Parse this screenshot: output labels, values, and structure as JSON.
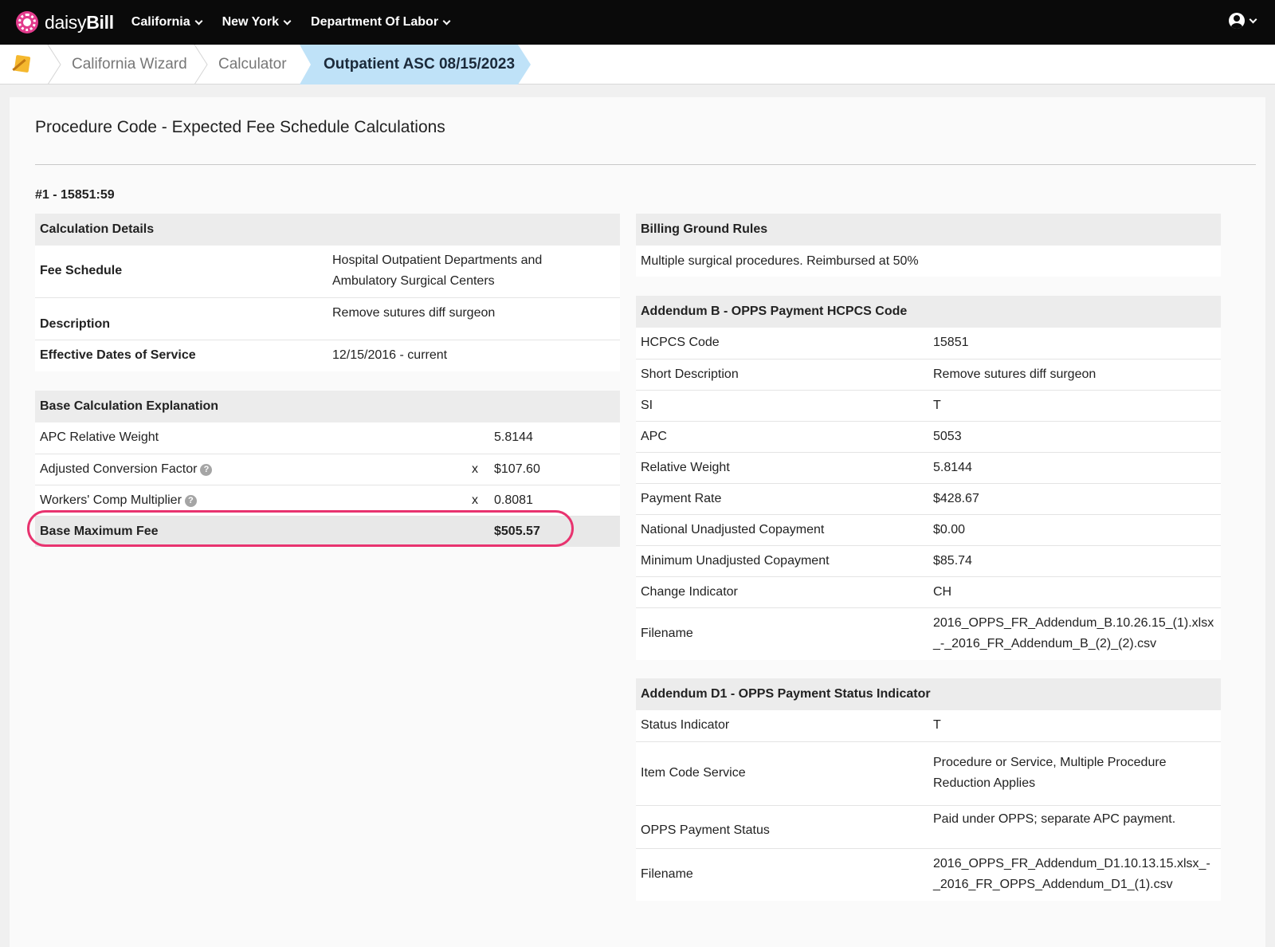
{
  "nav": {
    "logo_light": "daisy",
    "logo_bold": "Bill",
    "items": [
      {
        "label": "California"
      },
      {
        "label": "New York"
      },
      {
        "label": "Department Of Labor"
      }
    ]
  },
  "breadcrumb": {
    "items": [
      "California Wizard",
      "Calculator"
    ],
    "active": "Outpatient ASC 08/15/2023"
  },
  "page": {
    "title": "Procedure Code - Expected Fee Schedule Calculations",
    "procedure_id": "#1 - 15851:59"
  },
  "calc_details": {
    "header": "Calculation Details",
    "rows": [
      {
        "label": "Fee Schedule",
        "value": "Hospital Outpatient Departments and Ambulatory Surgical Centers"
      },
      {
        "label": "Description",
        "value": "Remove sutures diff surgeon"
      },
      {
        "label": "Effective Dates of Service",
        "value": "12/15/2016 - current"
      }
    ]
  },
  "base_calc": {
    "header": "Base Calculation Explanation",
    "rows": [
      {
        "label": "APC Relative Weight",
        "op": "",
        "value": "5.8144"
      },
      {
        "label": "Adjusted Conversion Factor",
        "op": "x",
        "value": "$107.60"
      },
      {
        "label": "Workers' Comp Multiplier",
        "op": "x",
        "value": "0.8081"
      }
    ],
    "total_label": "Base Maximum Fee",
    "total_value": "$505.57"
  },
  "billing_rules": {
    "header": "Billing Ground Rules",
    "text": "Multiple surgical procedures. Reimbursed at 50%"
  },
  "addendum_b": {
    "header": "Addendum B - OPPS Payment HCPCS Code",
    "rows": [
      {
        "label": "HCPCS Code",
        "value": "15851"
      },
      {
        "label": "Short Description",
        "value": "Remove sutures diff surgeon"
      },
      {
        "label": "SI",
        "value": "T"
      },
      {
        "label": "APC",
        "value": "5053"
      },
      {
        "label": "Relative Weight",
        "value": "5.8144"
      },
      {
        "label": "Payment Rate",
        "value": "$428.67"
      },
      {
        "label": "National Unadjusted Copayment",
        "value": "$0.00"
      },
      {
        "label": "Minimum Unadjusted Copayment",
        "value": "$85.74"
      },
      {
        "label": "Change Indicator",
        "value": "CH"
      },
      {
        "label": "Filename",
        "value_line1": "2016_OPPS_FR_Addendum_B.10.26.15_(1).xlsx",
        "value_line2": "_-_2016_FR_Addendum_B_(2)_(2).csv"
      }
    ]
  },
  "addendum_d1": {
    "header": "Addendum D1 - OPPS Payment Status Indicator",
    "rows": [
      {
        "label": "Status Indicator",
        "value": "T"
      },
      {
        "label": "Item Code Service",
        "value": "Procedure or Service, Multiple Procedure Reduction Applies"
      },
      {
        "label": "OPPS Payment Status",
        "value": "Paid under OPPS; separate APC payment."
      },
      {
        "label": "Filename",
        "value_line1": "2016_OPPS_FR_Addendum_D1.10.13.15.xlsx_-",
        "value_line2": "_2016_FR_OPPS_Addendum_D1_(1).csv"
      }
    ]
  },
  "colors": {
    "nav_bg": "#0a0a0a",
    "brand": "#e23b8c",
    "breadcrumb_active": "#bfe2f8",
    "highlight_circle": "#e8336f"
  }
}
